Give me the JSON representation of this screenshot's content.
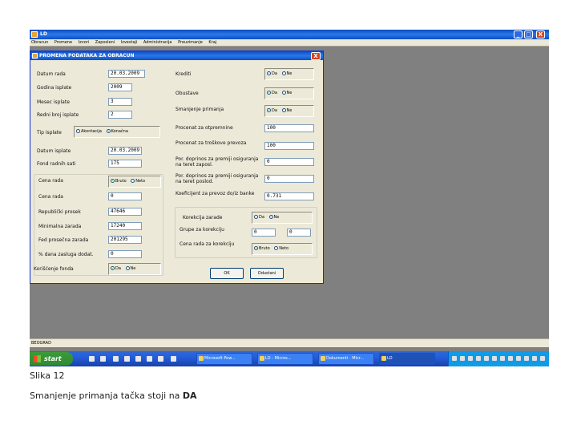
{
  "app": {
    "title": "LD",
    "menu": [
      "Obracun",
      "Promene",
      "Izvori",
      "Zaposleni",
      "Izvestaji",
      "Administracija",
      "Preuzimanje",
      "Kraj"
    ],
    "window_buttons": {
      "minimize": "_",
      "restore": "□",
      "close": "X"
    }
  },
  "dialog": {
    "title": "PROMENA PODATAKA ZA OBRACUN",
    "close": "X",
    "left": {
      "datum_rada": {
        "label": "Datum rada",
        "value": "20.03.2009"
      },
      "godina_isplate": {
        "label": "Godina isplate",
        "value": "2009"
      },
      "mesec_isplate": {
        "label": "Mesec isplate",
        "value": "3"
      },
      "redni_broj": {
        "label": "Redni broj isplate",
        "value": "2"
      },
      "tip_isplate": {
        "label": "Tip isplate",
        "options": [
          "Akontacija",
          "Konačna"
        ],
        "selected": 1
      },
      "datum_isplate": {
        "label": "Datum isplate",
        "value": "20.03.2009"
      },
      "fond_sati": {
        "label": "Fond radnih sati",
        "value": "175"
      },
      "cena_rada_tip": {
        "label": "Cena rada",
        "options": [
          "Bruto",
          "Neto"
        ],
        "selected": 0
      },
      "cena_rada": {
        "label": "Cena rada",
        "value": "0"
      },
      "republicki_prosek": {
        "label": "Republički prosek",
        "value": "47646"
      },
      "minimalna_zarada": {
        "label": "Minimalna zarada",
        "value": "17240"
      },
      "fed_prosecna_zarada": {
        "label": "Fed prosečna zarada",
        "value": "201295"
      },
      "dana_zaslug": {
        "label": "% dana zasluga dodat.",
        "value": "0"
      },
      "koriscenje_fonda": {
        "label": "Korišćenje fonda",
        "options": [
          "Da",
          "Ne"
        ],
        "selected": 0
      }
    },
    "right": {
      "krediti": {
        "label": "Krediti",
        "options": [
          "Da",
          "Ne"
        ],
        "selected": 0
      },
      "obustave": {
        "label": "Obustave",
        "options": [
          "Da",
          "Ne"
        ],
        "selected": 0
      },
      "smanjenje_primanja": {
        "label": "Smanjenje primanja",
        "options": [
          "Da",
          "Ne"
        ],
        "selected": 0
      },
      "procenat_prvi": {
        "label": "Procenat za otpremnine",
        "value": "100"
      },
      "procenat_drugi": {
        "label": "Procenat za troškove prevoza",
        "value": "100"
      },
      "por_doprinos_odbici": {
        "label": "Por. doprinos za premiji osiguranja na teret zaposl.",
        "value": "0"
      },
      "por_doprinos_poslod": {
        "label": "Por. doprinos za premiji osiguranja na teret poslod.",
        "value": "0"
      },
      "koeficijent": {
        "label": "Koeficijent za prevoz do/iz banke",
        "value": "0.731"
      },
      "korekcija_zarade": {
        "label": "Korekcija zarade",
        "options": [
          "Da",
          "Ne"
        ],
        "selected": 1
      },
      "grupe_korekcija": {
        "label": "Grupe za korekciju",
        "value_a": "0",
        "value_b": "0"
      },
      "cena_rada_korekcija": {
        "label": "Cena rada za korekciju",
        "options": [
          "Bruto",
          "Neto"
        ],
        "selected": 0
      }
    },
    "ok": "OK",
    "cancel": "Odustani"
  },
  "statusbar": {
    "text": "BEOGRAD"
  },
  "taskbar": {
    "start": "start",
    "tasks": [
      "Microsoft Pow...",
      "LD - Micros...",
      "Dokumenti - Micr...",
      "LD"
    ]
  },
  "caption": {
    "line1": "Slika 12",
    "line2_prefix": "Smanjenje primanja tačka stoji na ",
    "line2_bold": "DA"
  }
}
